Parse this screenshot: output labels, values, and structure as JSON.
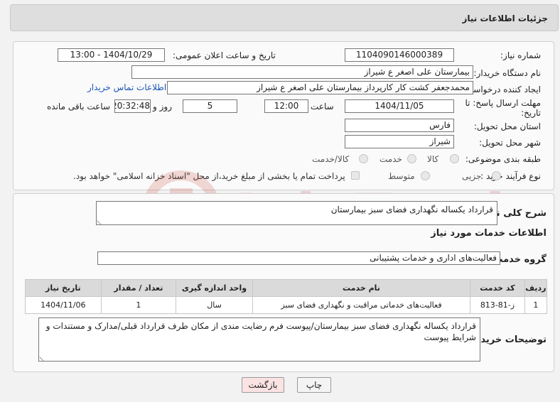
{
  "header": {
    "title": "جزئیات اطلاعات نیاز"
  },
  "form": {
    "need_number_label": "شماره نیاز:",
    "need_number": "1104090146000389",
    "announce_label": "تاریخ و ساعت اعلان عمومی:",
    "announce_value": "1404/10/29 - 13:00",
    "buyer_org_label": "نام دستگاه خریدار:",
    "buyer_org": "بیمارستان علی اصغر  ع  شیراز",
    "creator_label": "ایجاد کننده درخواست:",
    "creator": "محمدجعفر کشت کار کارپرداز بیمارستان علی اصغر  ع  شیراز",
    "contact_link": "اطلاعات تماس خریدار",
    "deadline_label_1": "مهلت ارسال پاسخ: تا",
    "deadline_label_2": "تاریخ:",
    "deadline_date": "1404/11/05",
    "time_label": "ساعت",
    "deadline_time": "12:00",
    "days_value": "5",
    "days_label": "روز و",
    "remaining_time": "20:32:48",
    "remaining_label": "ساعت باقی مانده",
    "province_label": "استان محل تحویل:",
    "province": "فارس",
    "city_label": "شهر محل تحویل:",
    "city": "شیراز",
    "category_label": "طبقه بندی موضوعی:",
    "category_options": [
      "کالا",
      "خدمت",
      "کالا/خدمت"
    ],
    "process_label": "نوع فرآیند خرید :",
    "process_options": [
      "جزیی",
      "متوسط"
    ],
    "payment_note": "پرداخت تمام یا بخشی از مبلغ خرید،از محل \"اسناد خزانه اسلامی\" خواهد بود."
  },
  "details": {
    "summary_label": "شرح کلی نیاز:",
    "summary": "قرارداد یکساله نگهداری فضای سبز بیمارستان",
    "services_heading": "اطلاعات خدمات مورد نیاز",
    "group_label": "گروه خدمت:",
    "group_value": "فعالیت‌های اداری و خدمات پشتیبانی",
    "table": {
      "headers": [
        "ردیف",
        "کد خدمت",
        "نام خدمت",
        "واحد اندازه گیری",
        "تعداد / مقدار",
        "تاریخ نیاز"
      ],
      "rows": [
        [
          "1",
          "ز-81-813",
          "فعالیت‌های خدماتی مراقبت و نگهداری فضای سبز",
          "سال",
          "1",
          "1404/11/06"
        ]
      ]
    },
    "buyer_notes_label": "توضیحات خریدار:",
    "buyer_notes": "قرارداد یکساله نگهداری فضای سبز بیمارستان/پیوست فرم رضایت مندی از مکان طرف قرارداد قبلی/مدارک و مستندات و شرایط پیوست"
  },
  "buttons": {
    "print": "چاپ",
    "back": "بازگشت"
  },
  "watermark": {
    "text": "AriaTender.neT"
  },
  "colors": {
    "link": "#1a56b8",
    "back_button_bg": "#fbe3e3",
    "print_button_bg": "#f4f4f4",
    "watermark": "#c0392b"
  }
}
